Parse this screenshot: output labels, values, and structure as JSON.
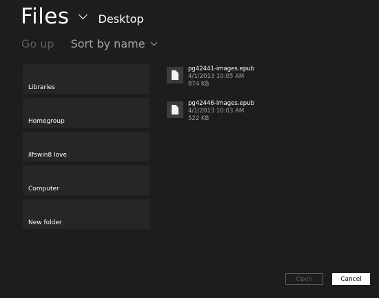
{
  "header": {
    "title": "Files",
    "location": "Desktop"
  },
  "toolbar": {
    "go_up_label": "Go up",
    "sort_label": "Sort by name"
  },
  "folders": [
    {
      "label": "Libraries"
    },
    {
      "label": "Homegroup"
    },
    {
      "label": "ilfswin8 love"
    },
    {
      "label": "Computer"
    },
    {
      "label": "New folder"
    }
  ],
  "files": [
    {
      "name": "pg42441-images.epub",
      "date": "4/1/2013 10:05 AM",
      "size": "874 KB",
      "icon": "document-icon"
    },
    {
      "name": "pg42446-images.epub",
      "date": "4/1/2013 10:03 AM",
      "size": "522 KB",
      "icon": "document-icon"
    }
  ],
  "buttons": {
    "open_label": "Open",
    "cancel_label": "Cancel"
  },
  "colors": {
    "background": "#1d1d1d",
    "tile": "#262626",
    "disabled_text": "#5c5c5c"
  }
}
